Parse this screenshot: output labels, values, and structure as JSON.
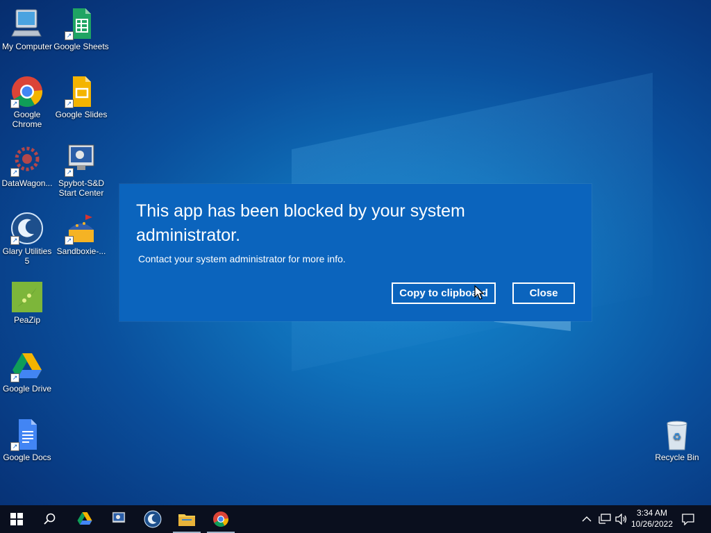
{
  "desktop": {
    "icons": [
      {
        "label": "My Computer"
      },
      {
        "label": "Google Sheets"
      },
      {
        "label": "Google Chrome"
      },
      {
        "label": "Google Slides"
      },
      {
        "label": "DataWagon..."
      },
      {
        "label": "Spybot-S&D Start Center"
      },
      {
        "label": "Glary Utilities 5"
      },
      {
        "label": "Sandboxie-..."
      },
      {
        "label": "PeaZip"
      },
      {
        "label": "Google Drive"
      },
      {
        "label": "Google Docs"
      },
      {
        "label": "Recycle Bin"
      }
    ]
  },
  "dialog": {
    "title": "This app has been blocked by your system administrator.",
    "message": "Contact your system administrator for more info.",
    "copy_label": "Copy to clipboard",
    "close_label": "Close"
  },
  "taskbar": {
    "apps": [
      {
        "icon": "google-drive-icon"
      },
      {
        "icon": "spybot-icon"
      },
      {
        "icon": "glary-utilities-icon"
      },
      {
        "icon": "file-explorer-icon"
      },
      {
        "icon": "chrome-icon"
      }
    ],
    "time": "3:34 AM",
    "date": "10/26/2022"
  },
  "colors": {
    "dialog_bg": "#0b64bd",
    "taskbar_bg": "#0a0f1e"
  }
}
